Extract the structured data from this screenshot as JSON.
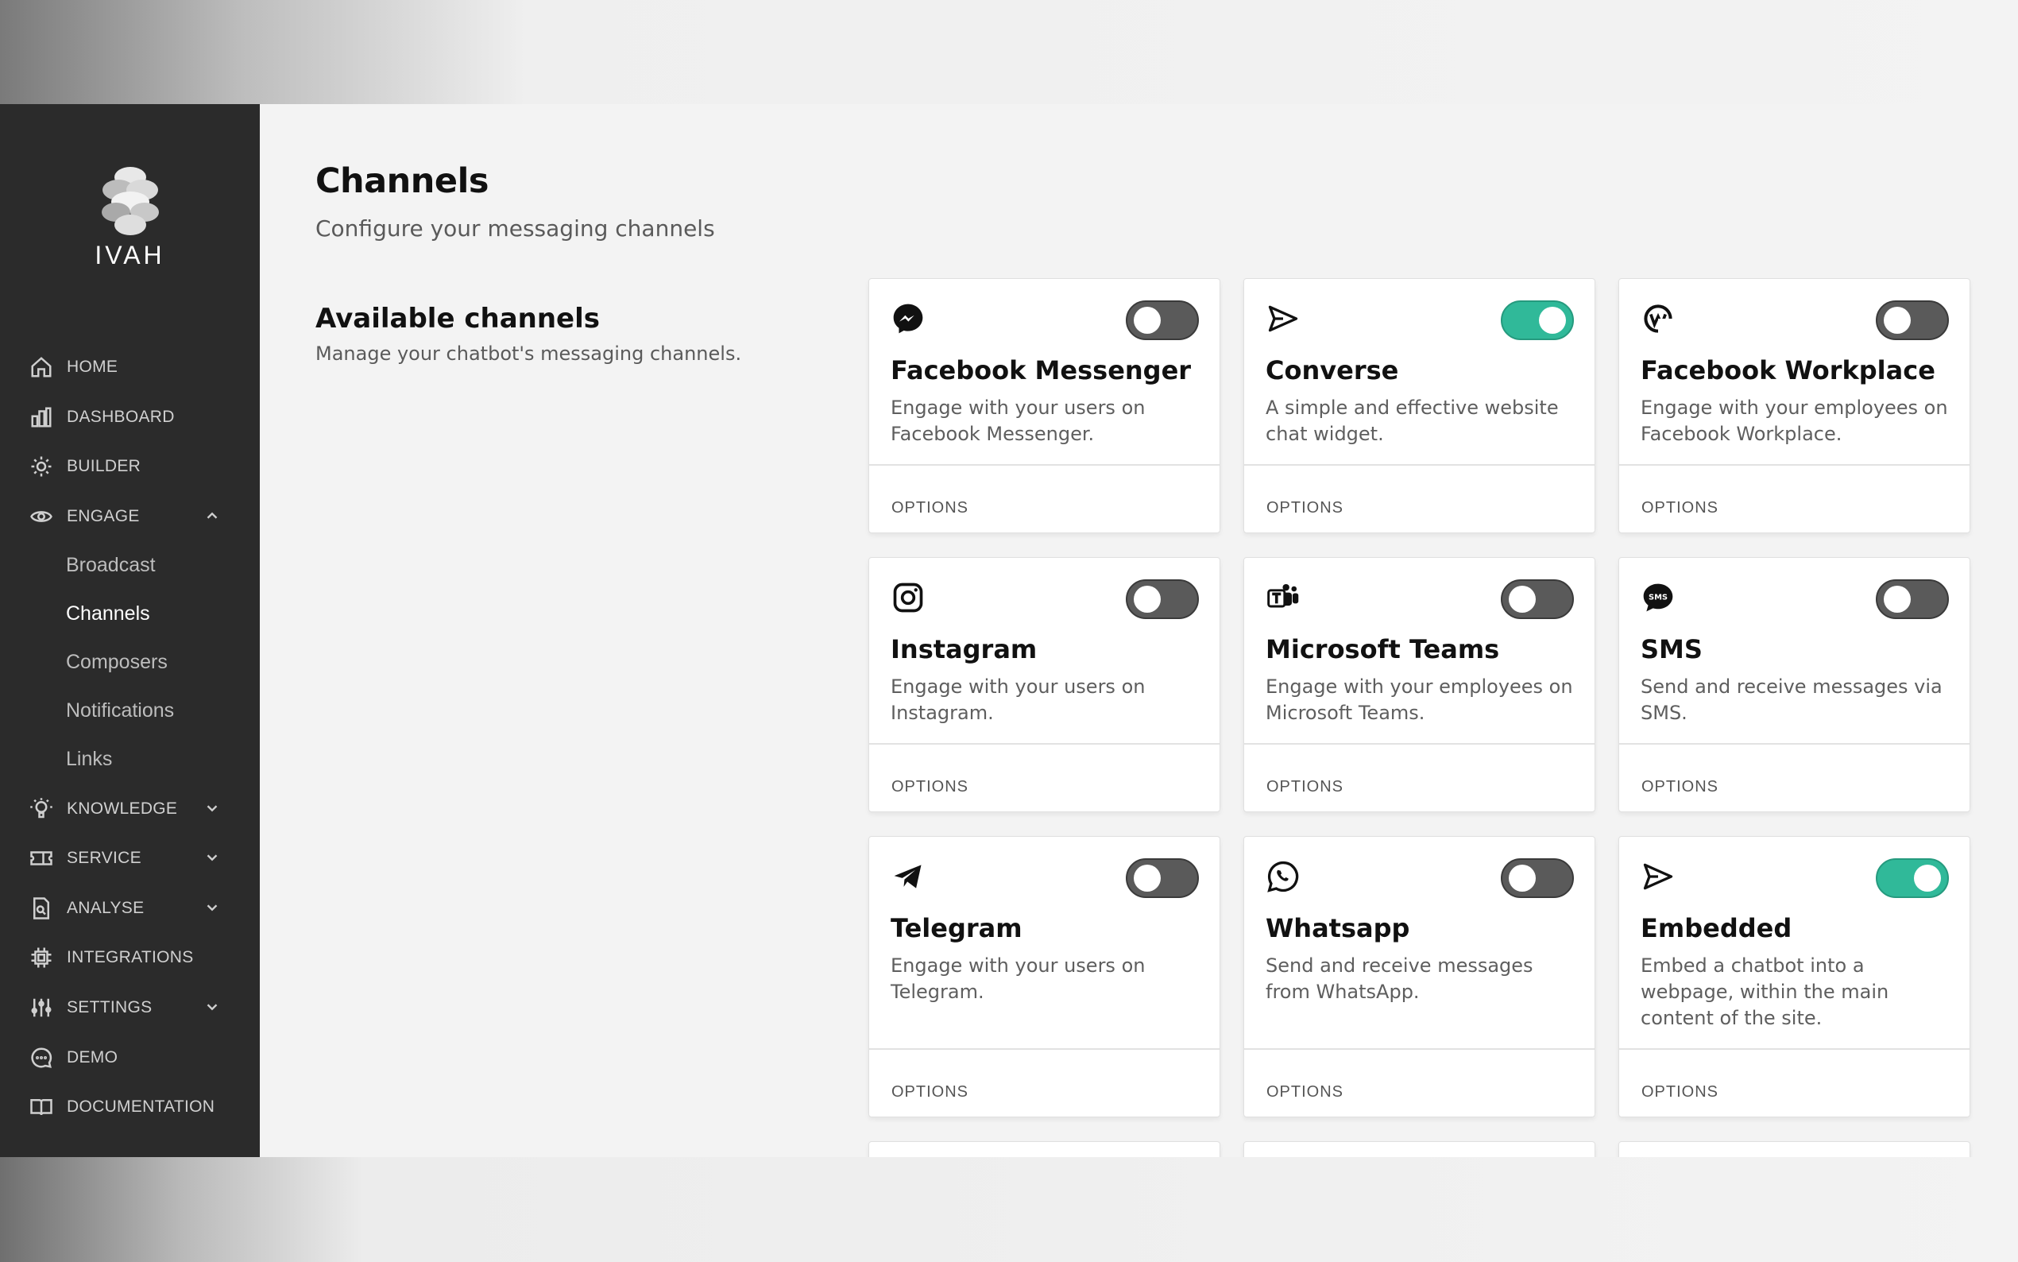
{
  "app": {
    "logo_text": "IVAH"
  },
  "sidebar": {
    "items": [
      {
        "label": "HOME",
        "icon": "home-icon"
      },
      {
        "label": "DASHBOARD",
        "icon": "bar-chart-icon"
      },
      {
        "label": "BUILDER",
        "icon": "builder-icon"
      },
      {
        "label": "ENGAGE",
        "icon": "eye-icon",
        "expanded": true
      },
      {
        "label": "KNOWLEDGE",
        "icon": "lightbulb-icon"
      },
      {
        "label": "SERVICE",
        "icon": "ticket-icon"
      },
      {
        "label": "ANALYSE",
        "icon": "document-search-icon"
      },
      {
        "label": "INTEGRATIONS",
        "icon": "chip-icon"
      },
      {
        "label": "SETTINGS",
        "icon": "sliders-icon"
      },
      {
        "label": "DEMO",
        "icon": "chat-bubble-icon"
      },
      {
        "label": "DOCUMENTATION",
        "icon": "book-icon"
      }
    ],
    "engage_sub": [
      {
        "label": "Broadcast"
      },
      {
        "label": "Channels",
        "active": true
      },
      {
        "label": "Composers"
      },
      {
        "label": "Notifications"
      },
      {
        "label": "Links"
      }
    ]
  },
  "page": {
    "title": "Channels",
    "subtitle": "Configure your messaging channels",
    "section_title": "Available channels",
    "section_subtitle": "Manage your chatbot's messaging channels."
  },
  "channels": [
    {
      "title": "Facebook Messenger",
      "description": "Engage with your users on Facebook Messenger.",
      "enabled": false,
      "icon": "messenger-icon",
      "options_label": "OPTIONS"
    },
    {
      "title": "Converse",
      "description": "A simple and effective website chat widget.",
      "enabled": true,
      "icon": "send-icon",
      "options_label": "OPTIONS"
    },
    {
      "title": "Facebook Workplace",
      "description": "Engage with your employees on Facebook Workplace.",
      "enabled": false,
      "icon": "workplace-icon",
      "options_label": "OPTIONS"
    },
    {
      "title": "Instagram",
      "description": "Engage with your users on Instagram.",
      "enabled": false,
      "icon": "instagram-icon",
      "options_label": "OPTIONS"
    },
    {
      "title": "Microsoft Teams",
      "description": "Engage with your employees on Microsoft Teams.",
      "enabled": false,
      "icon": "teams-icon",
      "options_label": "OPTIONS"
    },
    {
      "title": "SMS",
      "description": "Send and receive messages via SMS.",
      "enabled": false,
      "icon": "sms-icon",
      "options_label": "OPTIONS"
    },
    {
      "title": "Telegram",
      "description": "Engage with your users on Telegram.",
      "enabled": false,
      "icon": "telegram-icon",
      "options_label": "OPTIONS"
    },
    {
      "title": "Whatsapp",
      "description": "Send and receive messages from WhatsApp.",
      "enabled": false,
      "icon": "whatsapp-icon",
      "options_label": "OPTIONS"
    },
    {
      "title": "Embedded",
      "description": "Embed a chatbot into a webpage, within the main content of the site.",
      "enabled": true,
      "icon": "send-icon",
      "options_label": "OPTIONS"
    }
  ],
  "colors": {
    "sidebar_bg": "#2b2b2b",
    "toggle_on": "#30b999",
    "toggle_off": "#5a5a5a",
    "page_bg": "#f3f3f3"
  }
}
